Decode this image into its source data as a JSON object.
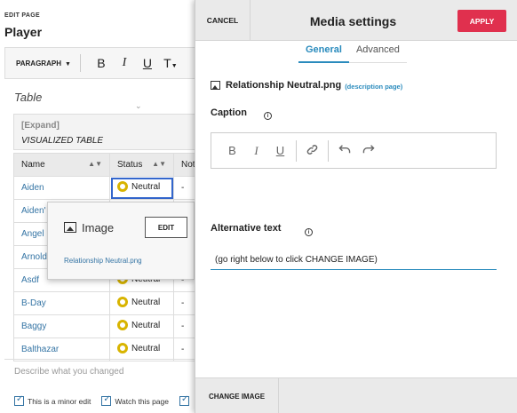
{
  "editor": {
    "edit_page_label": "EDIT PAGE",
    "page_title": "Player",
    "toolbar": {
      "paragraph_label": "PARAGRAPH",
      "bold": "B",
      "italic": "I",
      "underline": "U",
      "text_style": "T"
    },
    "doc_heading": "Table",
    "visualized_table": {
      "expand_label": "[Expand]",
      "title": "VISUALIZED TABLE"
    },
    "table": {
      "columns": [
        "Name",
        "Status",
        "Not"
      ],
      "rows": [
        {
          "name": "Aiden",
          "status": "Neutral",
          "notes": "-"
        },
        {
          "name": "Aiden'",
          "status": "",
          "notes": ""
        },
        {
          "name": "Angel",
          "status": "",
          "notes": ""
        },
        {
          "name": "Arnold",
          "status": "",
          "notes": ""
        },
        {
          "name": "Asdf",
          "status": "Neutral",
          "notes": "-"
        },
        {
          "name": "B-Day",
          "status": "Neutral",
          "notes": "-"
        },
        {
          "name": "Baggy",
          "status": "Neutral",
          "notes": "-"
        },
        {
          "name": "Balthazar",
          "status": "Neutral",
          "notes": "-"
        }
      ]
    },
    "image_popup": {
      "label": "Image",
      "edit_button": "EDIT",
      "file_link": "Relationship Neutral.png"
    },
    "summary_placeholder": "Describe what you changed",
    "checkboxes": [
      {
        "label": "This is a minor edit",
        "checked": true
      },
      {
        "label": "Watch this page",
        "checked": true
      },
      {
        "label": "",
        "checked": true
      }
    ]
  },
  "dialog": {
    "cancel": "CANCEL",
    "title": "Media settings",
    "apply": "APPLY",
    "tabs": [
      {
        "label": "General",
        "active": true
      },
      {
        "label": "Advanced",
        "active": false
      }
    ],
    "file_name": "Relationship Neutral.png",
    "description_link": "(description page)",
    "caption_label": "Caption",
    "alt_text_label": "Alternative text",
    "alt_text_value": "(go right below to click CHANGE IMAGE)",
    "change_image": "CHANGE IMAGE"
  },
  "colors": {
    "accent": "#2a8bbd",
    "apply_button": "#e0304e",
    "link": "#3474a4",
    "status_neutral": "#d8b400"
  },
  "icons": {
    "image": "image-icon",
    "info": "info-icon",
    "link": "link-icon",
    "undo": "undo-icon",
    "redo": "redo-icon"
  }
}
